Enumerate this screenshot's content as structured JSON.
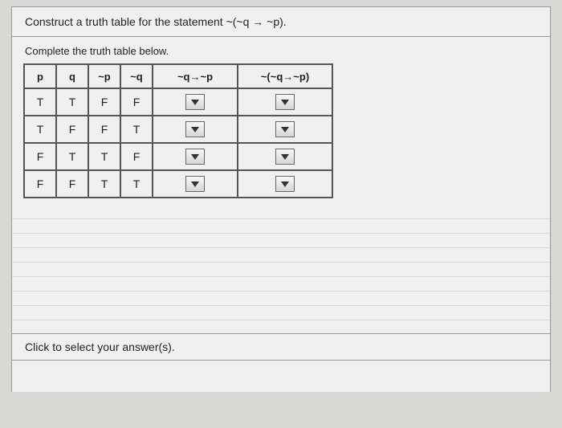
{
  "prompt": "Construct a truth table for the statement ~(~q → ~p).",
  "instruction": "Complete the truth table below.",
  "table": {
    "headers": [
      "p",
      "q",
      "~p",
      "~q",
      "~q→~p",
      "~(~q→~p)"
    ],
    "rows": [
      {
        "p": "T",
        "q": "T",
        "notp": "F",
        "notq": "F"
      },
      {
        "p": "T",
        "q": "F",
        "notp": "F",
        "notq": "T"
      },
      {
        "p": "F",
        "q": "T",
        "notp": "T",
        "notq": "F"
      },
      {
        "p": "F",
        "q": "F",
        "notp": "T",
        "notq": "T"
      }
    ]
  },
  "footer": "Click to select your answer(s)."
}
